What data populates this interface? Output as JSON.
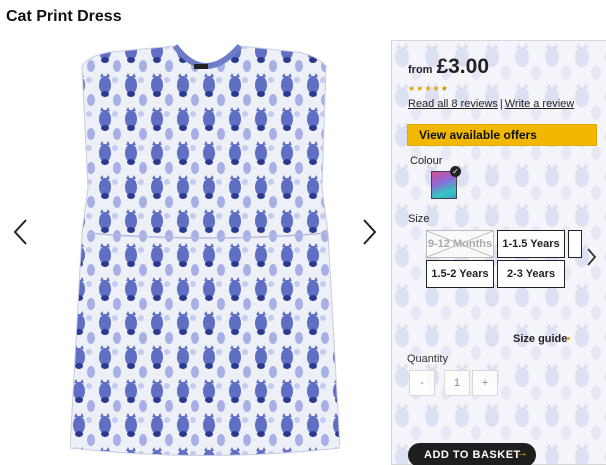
{
  "product": {
    "title": "Cat Print Dress"
  },
  "gallery": {
    "prev_icon": "chevron-left-icon",
    "next_icon": "chevron-right-icon"
  },
  "pricing": {
    "from_label": "from",
    "price": "£3.00",
    "rating": 4.5,
    "rating_max": 5
  },
  "reviews": {
    "read_link": "Read all 8 reviews",
    "separator": "|",
    "write_link": "Write a review"
  },
  "offers": {
    "label": "View available offers",
    "color": "#f2b800"
  },
  "colour": {
    "label": "Colour",
    "selected_icon": "check-icon"
  },
  "size": {
    "label": "Size",
    "options": [
      {
        "label": "9-12 Months",
        "available": false
      },
      {
        "label": "1-1.5 Years",
        "available": true
      },
      {
        "label": "1.5-2 Years",
        "available": true
      },
      {
        "label": "2-3 Years",
        "available": true
      }
    ],
    "next_icon": "chevron-right-icon"
  },
  "size_guide": {
    "label": "Size guide"
  },
  "quantity": {
    "label": "Quantity",
    "decrement": "-",
    "value": "1",
    "increment": "+"
  },
  "basket": {
    "label": "ADD TO BASKET",
    "arrow": "→"
  }
}
